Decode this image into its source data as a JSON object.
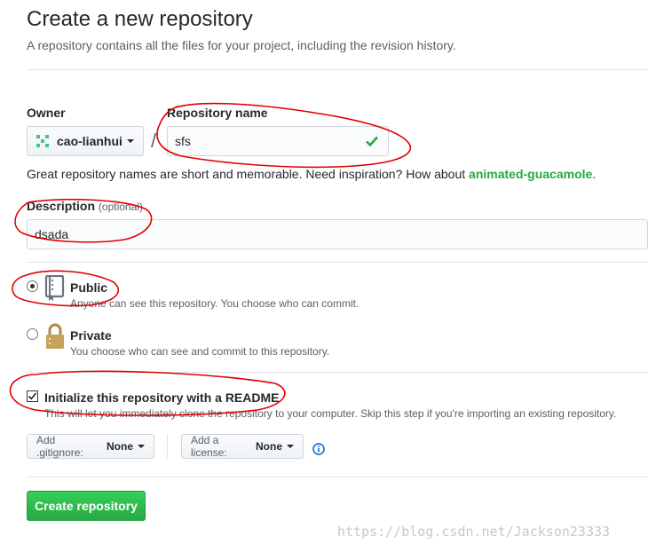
{
  "header": {
    "title": "Create a new repository",
    "subtitle": "A repository contains all the files for your project, including the revision history."
  },
  "owner": {
    "label": "Owner",
    "value": "cao-lianhui",
    "avatar_color": "#44c38d"
  },
  "repository": {
    "label": "Repository name",
    "separator": "/",
    "value": "sfs",
    "valid_icon": "check-icon",
    "valid_color": "#28a745"
  },
  "hint": {
    "text": "Great repository names are short and memorable. Need inspiration? How about ",
    "suggestion": "animated-guacamole",
    "end": "."
  },
  "description": {
    "label": "Description",
    "optional": "(optional)",
    "value": "dsada"
  },
  "visibility": {
    "public": {
      "title": "Public",
      "desc": "Anyone can see this repository. You choose who can commit.",
      "icon": "repo-book-icon",
      "selected": true
    },
    "private": {
      "title": "Private",
      "desc": "You choose who can see and commit to this repository.",
      "icon": "lock-icon",
      "selected": false
    }
  },
  "readme": {
    "title": "Initialize this repository with a README",
    "desc": "This will let you immediately clone the repository to your computer. Skip this step if you're importing an existing repository.",
    "checked": true
  },
  "gitignore": {
    "label": "Add .gitignore:",
    "value": "None"
  },
  "license": {
    "label": "Add a license:",
    "value": "None",
    "info_icon": "info-icon"
  },
  "submit": {
    "label": "Create repository",
    "color": "#28a745"
  },
  "watermark": "https://blog.csdn.net/Jackson23333",
  "annotation_color": "#e00000"
}
